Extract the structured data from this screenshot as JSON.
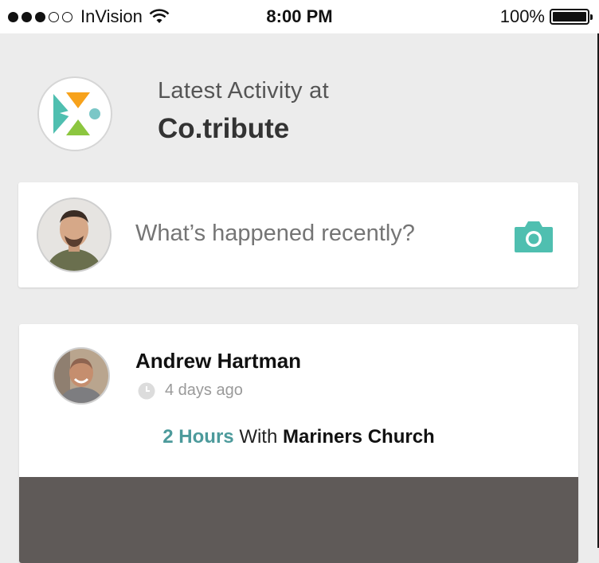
{
  "status_bar": {
    "carrier": "InVision",
    "time": "8:00 PM",
    "battery": "100%",
    "signal_bars_filled": 3,
    "signal_bars_total": 5
  },
  "header": {
    "subtitle": "Latest Activity at",
    "title": "Co.tribute",
    "logo": "cotribute-logo"
  },
  "composer": {
    "placeholder": "What’s happened recently?",
    "camera_icon": "camera-icon"
  },
  "activity": {
    "user_name": "Andrew Hartman",
    "time_ago": "4 days ago",
    "hours": "2 Hours",
    "with_text": "With",
    "organization": "Mariners Church"
  },
  "colors": {
    "accent": "#4fbfb0",
    "hours_text": "#4c9a9b",
    "logo_orange": "#f7a21b",
    "logo_green": "#8cc63f",
    "logo_teal": "#4fbfb0",
    "background": "#ececec"
  }
}
